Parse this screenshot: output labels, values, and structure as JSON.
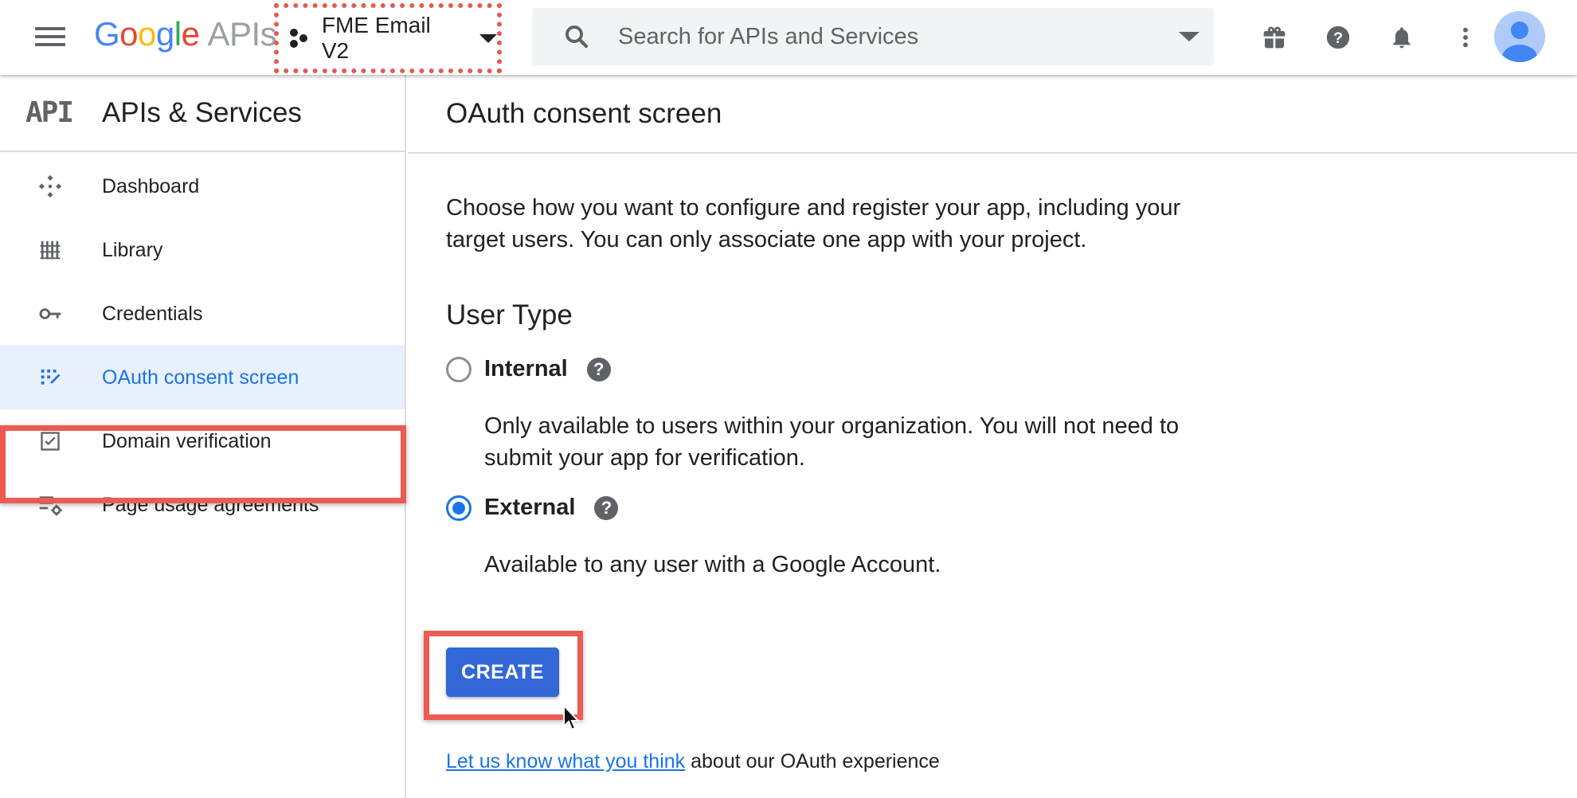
{
  "topbar": {
    "logo": {
      "letters": [
        "G",
        "o",
        "o",
        "g",
        "l",
        "e"
      ],
      "suffix": "APIs"
    },
    "project": {
      "name": "FME Email V2"
    },
    "search": {
      "placeholder": "Search for APIs and Services"
    },
    "icons": [
      "gift-icon",
      "help-icon",
      "bell-icon",
      "more-vert-icon"
    ]
  },
  "sidebar": {
    "logo_text": "API",
    "title": "APIs & Services",
    "items": [
      {
        "label": "Dashboard",
        "icon": "dashboard-icon",
        "active": false
      },
      {
        "label": "Library",
        "icon": "library-icon",
        "active": false
      },
      {
        "label": "Credentials",
        "icon": "key-icon",
        "active": false
      },
      {
        "label": "OAuth consent screen",
        "icon": "consent-icon",
        "active": true
      },
      {
        "label": "Domain verification",
        "icon": "checkbox-icon",
        "active": false
      },
      {
        "label": "Page usage agreements",
        "icon": "settings-list-icon",
        "active": false
      }
    ]
  },
  "main": {
    "title": "OAuth consent screen",
    "description": "Choose how you want to configure and register your app, including your target users. You can only associate one app with your project.",
    "user_type": {
      "title": "User Type",
      "options": [
        {
          "label": "Internal",
          "checked": false,
          "description": "Only available to users within your organization. You will not need to submit your app for verification."
        },
        {
          "label": "External",
          "checked": true,
          "description": "Available to any user with a Google Account."
        }
      ]
    },
    "create_label": "CREATE",
    "feedback": {
      "link_text": "Let us know what you think",
      "rest": " about our OAuth experience"
    }
  },
  "colors": {
    "accent": "#1a73e8",
    "button": "#3367d6",
    "highlight_outline": "#ec5b52",
    "active_bg": "#e8f0fe"
  }
}
